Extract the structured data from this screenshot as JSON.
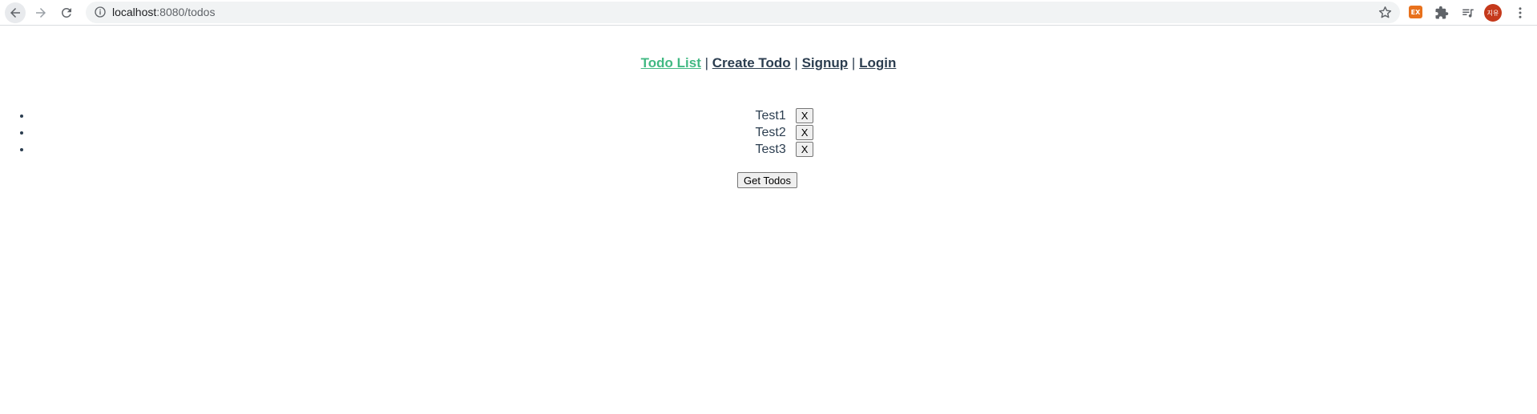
{
  "browser": {
    "url_host": "localhost",
    "url_rest": ":8080/todos",
    "extension_badge": "EX",
    "avatar_text": "지유"
  },
  "nav": {
    "items": [
      {
        "label": "Todo List",
        "active": true
      },
      {
        "label": "Create Todo",
        "active": false
      },
      {
        "label": "Signup",
        "active": false
      },
      {
        "label": "Login",
        "active": false
      }
    ],
    "separator": "|"
  },
  "todos": [
    {
      "title": "Test1",
      "delete_label": "X"
    },
    {
      "title": "Test2",
      "delete_label": "X"
    },
    {
      "title": "Test3",
      "delete_label": "X"
    }
  ],
  "actions": {
    "get_todos_label": "Get Todos"
  },
  "colors": {
    "active_link": "#42b983",
    "text": "#2c3e50"
  }
}
